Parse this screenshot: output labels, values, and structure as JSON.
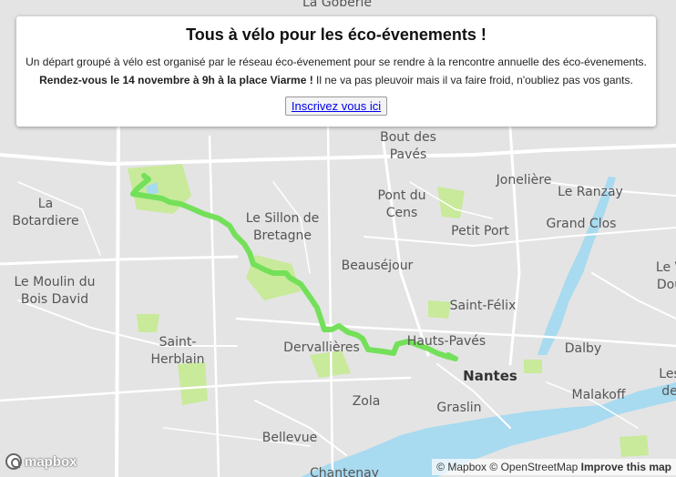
{
  "overlay": {
    "title": "Tous à vélo pour les éco-évenements !",
    "description": "Un départ groupé à vélo est organisé par le réseau éco-évenement pour se rendre à la rencontre annuelle des éco-évenements.",
    "rdv_bold": "Rendez-vous le 14 novembre à 9h à la place Viarme !",
    "rdv_rest": " Il ne va pas pleuvoir mais il va faire froid, n'oubliez pas vos gants.",
    "cta_label": "Inscrivez vous ici"
  },
  "map": {
    "places": {
      "la_goberie": "La Goberie",
      "la_botardiere_1": "La",
      "la_botardiere_2": "Botardiere",
      "moulin_1": "Le Moulin du",
      "moulin_2": "Bois David",
      "sillon_1": "Le Sillon de",
      "sillon_2": "Bretagne",
      "bout_1": "Bout des",
      "bout_2": "Pavés",
      "pont_1": "Pont du",
      "pont_2": "Cens",
      "joneliere": "Jonelière",
      "ranzay": "Le Ranzay",
      "grand_clos": "Grand Clos",
      "petit_port": "Petit Port",
      "beausejour": "Beauséjour",
      "saint_felix": "Saint-Félix",
      "le_v_1": "Le V",
      "le_v_2": "Dou",
      "saint_herblain_1": "Saint-",
      "saint_herblain_2": "Herblain",
      "dervallieres": "Dervallières",
      "hauts_paves": "Hauts-Pavés",
      "nantes": "Nantes",
      "dalby": "Dalby",
      "zola": "Zola",
      "graslin": "Graslin",
      "malakoff": "Malakoff",
      "bellevue": "Bellevue",
      "chantenay": "Chantenay",
      "les": "Les",
      "de": "de"
    },
    "route_color": "#74e05a",
    "water_color": "#a8daf0",
    "park_color": "#c8ea9a"
  },
  "logo": {
    "text": "mapbox"
  },
  "attribution": {
    "mapbox": "© Mapbox",
    "osm": "© OpenStreetMap",
    "improve": "Improve this map"
  }
}
